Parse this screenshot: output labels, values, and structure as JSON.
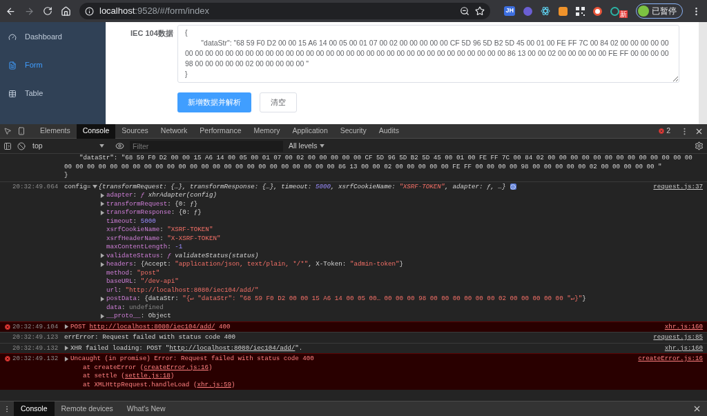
{
  "browser": {
    "url_host": "localhost",
    "url_rest": ":9528/#/form/index",
    "extension_label": "JH",
    "new_badge": "新",
    "profile_label": "已暂停"
  },
  "sidebar": {
    "items": [
      {
        "label": "Dashboard",
        "kind": "dashboard",
        "selected": false
      },
      {
        "label": "Form",
        "kind": "form",
        "selected": true
      },
      {
        "label": "Table",
        "kind": "table",
        "selected": false
      }
    ]
  },
  "form": {
    "label": "IEC 104数据",
    "value": "{\n        \"dataStr\": \"68 59 F0 D2 00 00 15 A6 14 00 05 00 01 07 00 02 00 00 00 00 00 CF 5D 96 5D B2 5D 45 00 01 00 FE FF 7C 00 84 02 00 00 00 00 00 00 00 00 00 00 00 00 00 00 00 00 00 00 00 00 00 00 00 00 00 00 00 00 00 00 00 00 00 00 00 00 00 86 13 00 00 02 00 00 00 00 00 FE FF 00 00 00 00 98 00 00 00 00 00 02 00 00 00 00 00 \"\n}",
    "buttons": [
      {
        "label": "新增数据并解析",
        "kind": "primary"
      },
      {
        "label": "清空",
        "kind": "default"
      }
    ]
  },
  "devtools": {
    "tabs": [
      {
        "label": "Elements",
        "selected": false
      },
      {
        "label": "Console",
        "selected": true
      },
      {
        "label": "Sources",
        "selected": false
      },
      {
        "label": "Network",
        "selected": false
      },
      {
        "label": "Performance",
        "selected": false
      },
      {
        "label": "Memory",
        "selected": false
      },
      {
        "label": "Application",
        "selected": false
      },
      {
        "label": "Security",
        "selected": false
      },
      {
        "label": "Audits",
        "selected": false
      }
    ],
    "error_count": "2",
    "context": "top",
    "filter_placeholder": "Filter",
    "levels": "All levels",
    "drawer_tabs": [
      {
        "label": "Console",
        "selected": true
      },
      {
        "label": "Remote devices",
        "selected": false
      },
      {
        "label": "What's New",
        "selected": false
      }
    ]
  },
  "console": {
    "continuation": [
      "    \"dataStr\": \"68 59 F0 D2 00 00 15 A6 14 00 05 00 01 07 00 02 00 00 00 00 00 CF 5D 96 5D B2 5D 45 00 01 00 FE FF 7C 00 84 02 00 00 00 00 00 00 00 00 00 00 00 00 00 00 00 00 00 00 00 00 00 00 00 00 00 00 00 00 00 00 00 00 00 00 00 00 00 86 13 00 00 02 00 00 00 00 00 FE FF 00 00 00 00 98 00 00 00 00 00 02 00 00 00 00 00 \"",
      "}"
    ],
    "messages": [
      {
        "kind": "object",
        "error": false,
        "time": "20:32:49.064",
        "info_badge": true,
        "source": "request.js:37",
        "parts": [
          {
            "kind": "plain",
            "text": "config="
          },
          {
            "kind": "preview",
            "text": "{transformRequest: {…}, transformResponse: {…}, timeout: "
          },
          {
            "kind": "preview-number",
            "text": "5000"
          },
          {
            "kind": "preview",
            "text": ", xsrfCookieName: "
          },
          {
            "kind": "preview-string",
            "text": "\"XSRF-TOKEN\""
          },
          {
            "kind": "preview",
            "text": ", adapter: ƒ, …}"
          }
        ],
        "children": [
          {
            "expandable": true,
            "parts": [
              {
                "kind": "key",
                "text": "adapter"
              },
              {
                "kind": "plain",
                "text": ": "
              },
              {
                "kind": "func",
                "text": "ƒ"
              },
              {
                "kind": "preview",
                "text": " xhrAdapter(config)"
              }
            ]
          },
          {
            "expandable": true,
            "parts": [
              {
                "kind": "key",
                "text": "transformRequest"
              },
              {
                "kind": "plain",
                "text": ": {0: ƒ}"
              }
            ]
          },
          {
            "expandable": true,
            "parts": [
              {
                "kind": "key",
                "text": "transformResponse"
              },
              {
                "kind": "plain",
                "text": ": {0: ƒ}"
              }
            ]
          },
          {
            "expandable": false,
            "parts": [
              {
                "kind": "key",
                "text": "timeout"
              },
              {
                "kind": "plain",
                "text": ": "
              },
              {
                "kind": "number",
                "text": "5000"
              }
            ]
          },
          {
            "expandable": false,
            "parts": [
              {
                "kind": "key",
                "text": "xsrfCookieName"
              },
              {
                "kind": "plain",
                "text": ": "
              },
              {
                "kind": "string",
                "text": "\"XSRF-TOKEN\""
              }
            ]
          },
          {
            "expandable": false,
            "parts": [
              {
                "kind": "key",
                "text": "xsrfHeaderName"
              },
              {
                "kind": "plain",
                "text": ": "
              },
              {
                "kind": "string",
                "text": "\"X-XSRF-TOKEN\""
              }
            ]
          },
          {
            "expandable": false,
            "parts": [
              {
                "kind": "key",
                "text": "maxContentLength"
              },
              {
                "kind": "plain",
                "text": ": "
              },
              {
                "kind": "number",
                "text": "-1"
              }
            ]
          },
          {
            "expandable": true,
            "parts": [
              {
                "kind": "key",
                "text": "validateStatus"
              },
              {
                "kind": "plain",
                "text": ": "
              },
              {
                "kind": "func",
                "text": "ƒ"
              },
              {
                "kind": "preview",
                "text": " validateStatus(status)"
              }
            ]
          },
          {
            "expandable": true,
            "parts": [
              {
                "kind": "key",
                "text": "headers"
              },
              {
                "kind": "plain",
                "text": ": {Accept: "
              },
              {
                "kind": "string",
                "text": "\"application/json, text/plain, */*\""
              },
              {
                "kind": "plain",
                "text": ", X-Token: "
              },
              {
                "kind": "string",
                "text": "\"admin-token\""
              },
              {
                "kind": "plain",
                "text": "}"
              }
            ]
          },
          {
            "expandable": false,
            "parts": [
              {
                "kind": "key",
                "text": "method"
              },
              {
                "kind": "plain",
                "text": ": "
              },
              {
                "kind": "string",
                "text": "\"post\""
              }
            ]
          },
          {
            "expandable": false,
            "parts": [
              {
                "kind": "key",
                "text": "baseURL"
              },
              {
                "kind": "plain",
                "text": ": "
              },
              {
                "kind": "string",
                "text": "\"/dev-api\""
              }
            ]
          },
          {
            "expandable": false,
            "parts": [
              {
                "kind": "key",
                "text": "url"
              },
              {
                "kind": "plain",
                "text": ": "
              },
              {
                "kind": "string",
                "text": "\"http://localhost:8080/iec104/add/\""
              }
            ]
          },
          {
            "expandable": true,
            "parts": [
              {
                "kind": "key",
                "text": "postData"
              },
              {
                "kind": "plain",
                "text": ": {dataStr: "
              },
              {
                "kind": "string",
                "text": "\"{↵ \"dataStr\": \"68 59 F0 D2 00 00 15 A6 14 00 05 00… 00 00 00 98 00 00 00 00 00 00 02 00 00 00 00 00 \"↵}\""
              },
              {
                "kind": "plain",
                "text": "}"
              }
            ]
          },
          {
            "expandable": false,
            "parts": [
              {
                "kind": "key",
                "text": "data"
              },
              {
                "kind": "plain",
                "text": ": "
              },
              {
                "kind": "dim",
                "text": "undefined"
              }
            ]
          },
          {
            "expandable": true,
            "parts": [
              {
                "kind": "key",
                "text": "__proto__"
              },
              {
                "kind": "plain",
                "text": ": Object"
              }
            ]
          }
        ]
      },
      {
        "kind": "group",
        "error": true,
        "time": "20:32:49.104",
        "info_badge": false,
        "source": "xhr.js:160",
        "parts": [
          {
            "kind": "error",
            "text": "POST "
          },
          {
            "kind": "error-link",
            "text": "http://localhost:8080/iec104/add/"
          },
          {
            "kind": "error",
            "text": " 400"
          }
        ]
      },
      {
        "kind": "text",
        "error": false,
        "time": "20:32:49.123",
        "info_badge": false,
        "source": "request.js:85",
        "parts": [
          {
            "kind": "plain",
            "text": "errError: Request failed with status code 400"
          }
        ]
      },
      {
        "kind": "group",
        "error": false,
        "time": "20:32:49.132",
        "info_badge": false,
        "source": "xhr.js:160",
        "parts": [
          {
            "kind": "plain",
            "text": "XHR failed loading: POST \""
          },
          {
            "kind": "link",
            "text": "http://localhost:8080/iec104/add/"
          },
          {
            "kind": "plain",
            "text": "\"."
          }
        ]
      },
      {
        "kind": "group",
        "error": true,
        "time": "20:32:49.132",
        "info_badge": false,
        "source": "createError.js:16",
        "parts": [
          {
            "kind": "error",
            "text": "Uncaught (in promise) Error: Request failed with status code 400"
          }
        ],
        "children": [
          {
            "expandable": false,
            "parts": [
              {
                "kind": "error",
                "text": "at createError ("
              },
              {
                "kind": "error-link",
                "text": "createError.js:16"
              },
              {
                "kind": "error",
                "text": ")"
              }
            ]
          },
          {
            "expandable": false,
            "parts": [
              {
                "kind": "error",
                "text": "at settle ("
              },
              {
                "kind": "error-link",
                "text": "settle.js:18"
              },
              {
                "kind": "error",
                "text": ")"
              }
            ]
          },
          {
            "expandable": false,
            "parts": [
              {
                "kind": "error",
                "text": "at XMLHttpRequest.handleLoad ("
              },
              {
                "kind": "error-link",
                "text": "xhr.js:59"
              },
              {
                "kind": "error",
                "text": ")"
              }
            ]
          }
        ]
      }
    ]
  }
}
